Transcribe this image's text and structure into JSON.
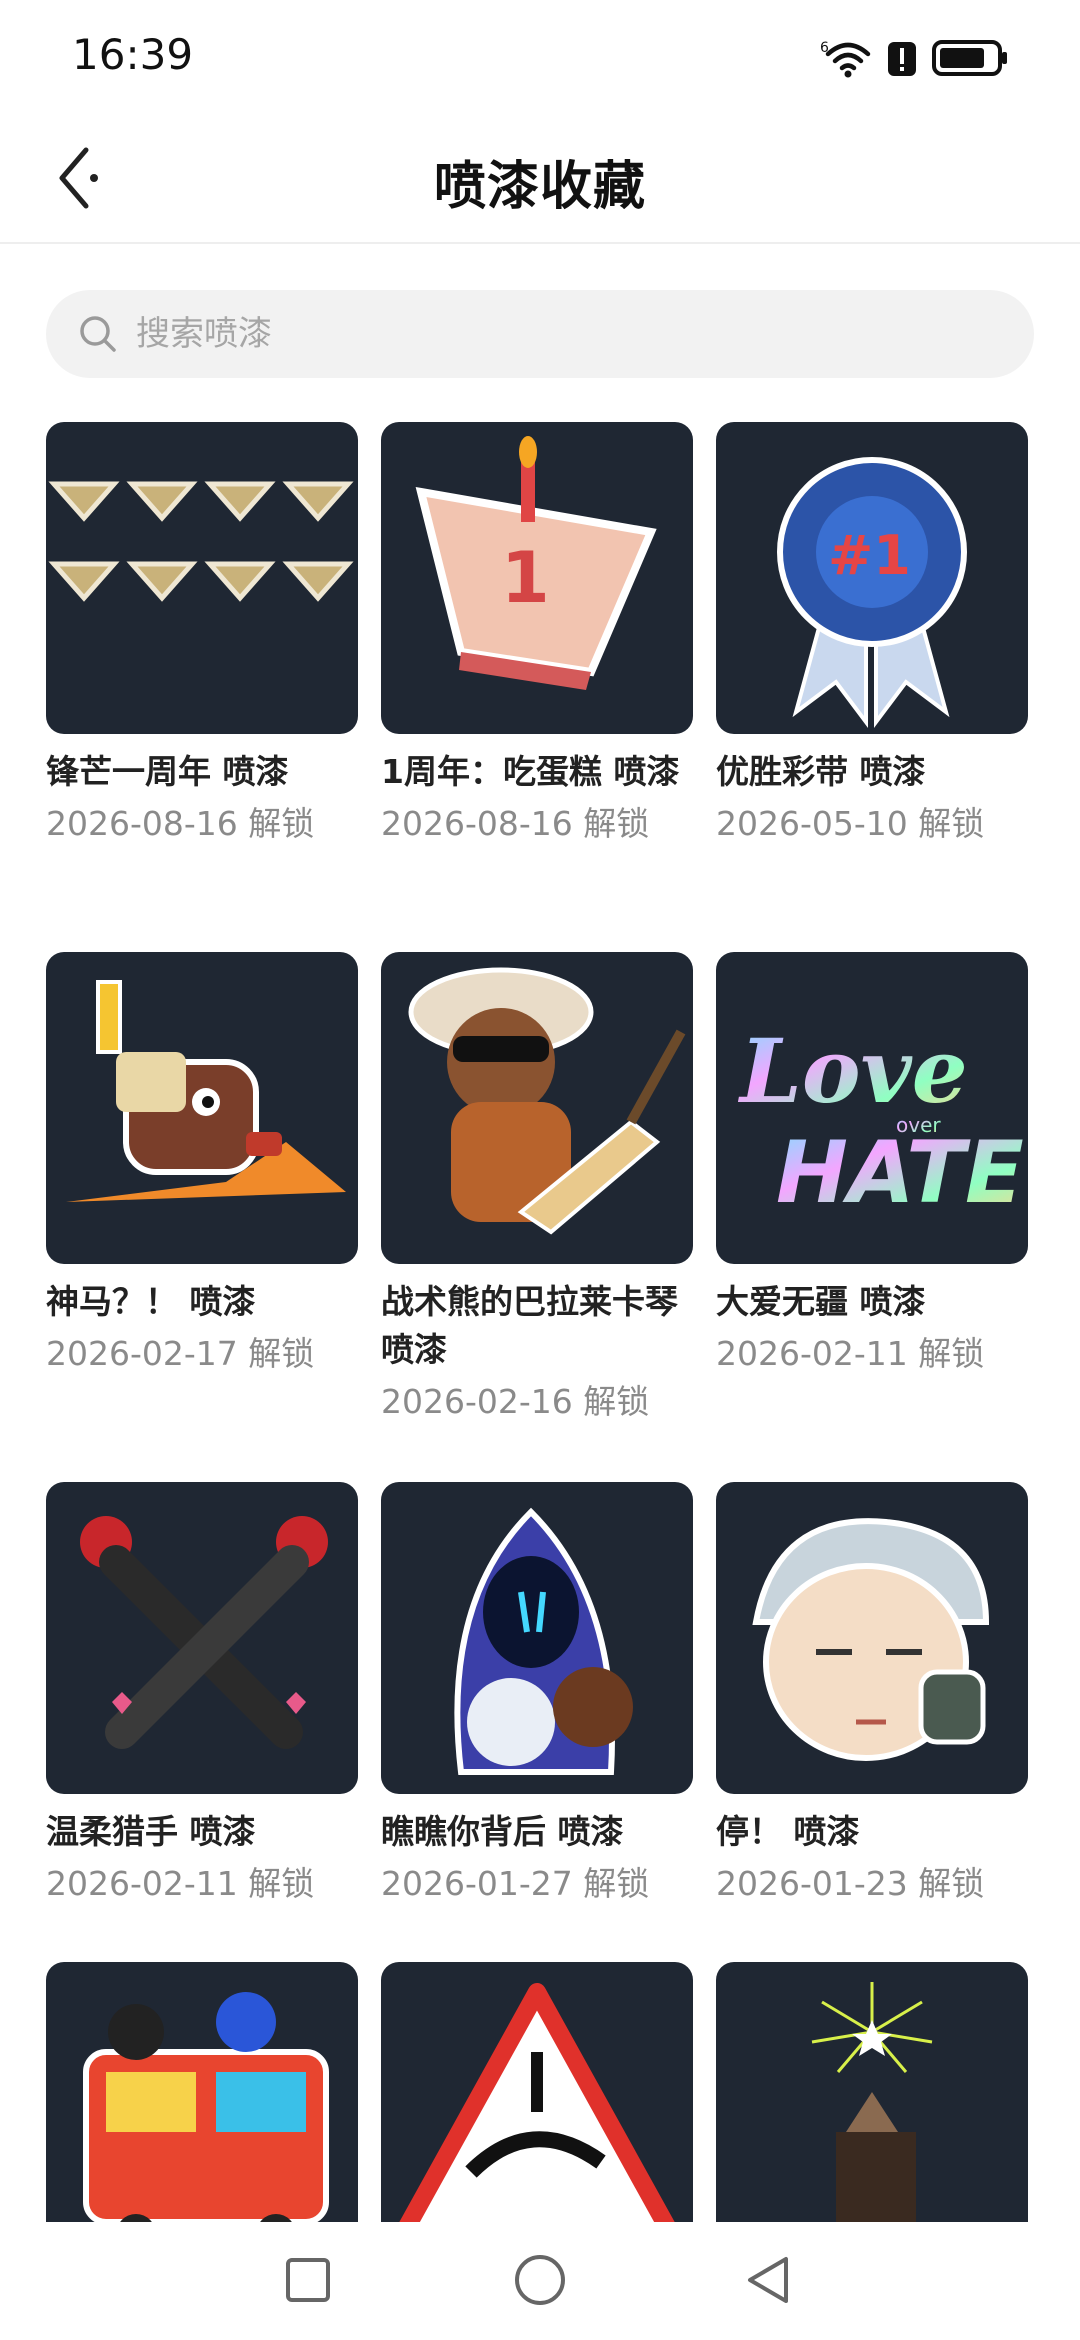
{
  "status_bar": {
    "time": "16:39",
    "icons": [
      "wifi-icon",
      "alert-icon",
      "battery-icon"
    ]
  },
  "header": {
    "title": "喷漆收藏",
    "back_icon": "back-chevron-icon"
  },
  "search": {
    "placeholder": "搜索喷漆",
    "value": ""
  },
  "sprays": [
    {
      "title": "锋芒一周年 喷漆",
      "date": "2026-08-16 解锁"
    },
    {
      "title": "1周年：吃蛋糕 喷漆",
      "date": "2026-08-16 解锁"
    },
    {
      "title": "优胜彩带 喷漆",
      "date": "2026-05-10 解锁"
    },
    {
      "title": "神马？！ 喷漆",
      "date": "2026-02-17 解锁"
    },
    {
      "title": "战术熊的巴拉莱卡琴 喷漆",
      "date": "2026-02-16 解锁"
    },
    {
      "title": "大爱无疆 喷漆",
      "date": "2026-02-11 解锁"
    },
    {
      "title": "温柔猎手 喷漆",
      "date": "2026-02-11 解锁"
    },
    {
      "title": "瞧瞧你背后 喷漆",
      "date": "2026-01-27 解锁"
    },
    {
      "title": "停！ 喷漆",
      "date": "2026-01-23 解锁"
    },
    {
      "title": "",
      "date": ""
    },
    {
      "title": "",
      "date": ""
    },
    {
      "title": "",
      "date": ""
    }
  ],
  "colors": {
    "card_bg": "#1f2733",
    "title": "#222222",
    "date": "#8a8a8a",
    "search_bg": "#f2f2f2"
  },
  "nav_bar": {
    "icons": [
      "recent-apps-icon",
      "home-icon",
      "back-icon"
    ]
  }
}
